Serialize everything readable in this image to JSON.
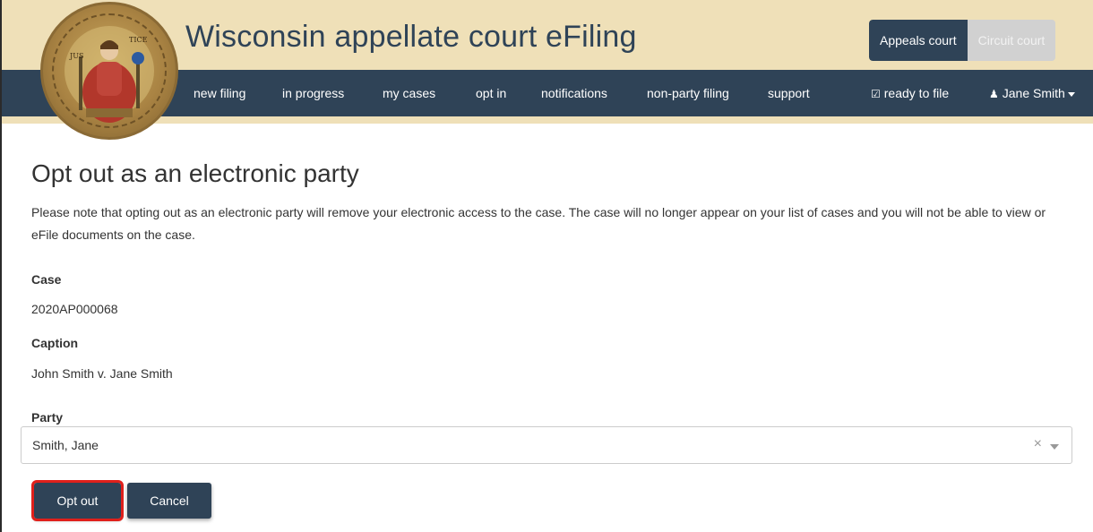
{
  "header": {
    "title": "Wisconsin appellate court eFiling",
    "court_toggle": {
      "active": "Appeals court",
      "inactive": "Circuit court"
    }
  },
  "nav": {
    "items": [
      "new filing",
      "in progress",
      "my cases",
      "opt in",
      "notifications",
      "non-party filing",
      "support"
    ],
    "ready_to_file": "ready to file",
    "ready_icon": "check-square-icon",
    "user_name": "Jane Smith",
    "user_icon": "user-icon"
  },
  "seal_text": [
    "JUS",
    "TICE"
  ],
  "page": {
    "title": "Opt out as an electronic party",
    "note": "Please note that opting out as an electronic party will remove your electronic access to the case. The case will no longer appear on your list of cases and you will not be able to view or eFile documents on the case."
  },
  "case": {
    "label": "Case",
    "value": "2020AP000068"
  },
  "caption": {
    "label": "Caption",
    "value": "John Smith v. Jane Smith"
  },
  "party": {
    "label": "Party",
    "selected": "Smith, Jane"
  },
  "buttons": {
    "opt_out": "Opt out",
    "cancel": "Cancel"
  },
  "colors": {
    "navy": "#2f4357",
    "banner": "#efe0b8",
    "highlight": "#e0201b"
  }
}
